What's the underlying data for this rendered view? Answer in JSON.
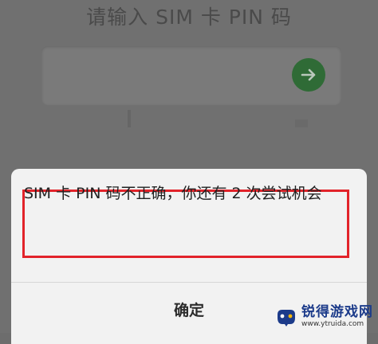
{
  "background_screen": {
    "title": "请输入 SIM 卡 PIN 码",
    "pin_input": {
      "value": "",
      "placeholder": ""
    },
    "submit_icon": "arrow-right-icon"
  },
  "dialog": {
    "message": "SIM 卡 PIN 码不正确，你还有 2 次尝试机会",
    "ok_label": "确定",
    "highlight_color": "#e2232a"
  },
  "watermark": {
    "title": "锐得游戏网",
    "url": "www.ytruida.com",
    "logo_icon": "game-controller-icon"
  }
}
